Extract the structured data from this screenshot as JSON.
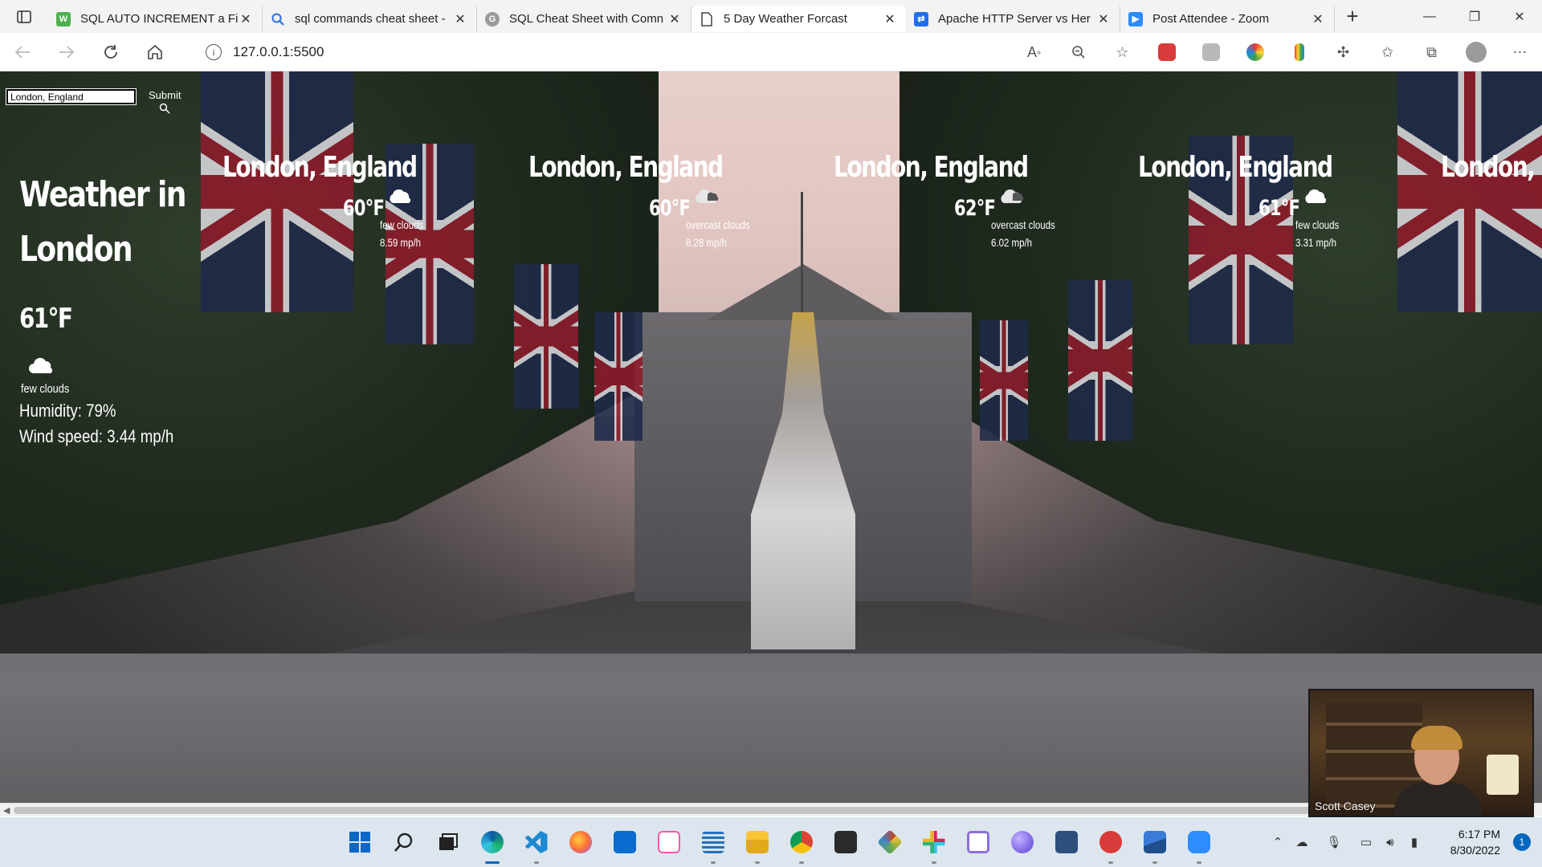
{
  "browser": {
    "tabs": [
      {
        "title": "SQL AUTO INCREMENT a Fi",
        "favicon": "w3schools-icon",
        "color": "#4caf50"
      },
      {
        "title": "sql commands cheat sheet -",
        "favicon": "search-icon",
        "color": "#2a6ee0"
      },
      {
        "title": "SQL Cheat Sheet with Comn",
        "favicon": "globe-icon",
        "color": "#888888"
      },
      {
        "title": "5 Day Weather Forcast",
        "favicon": "document-icon",
        "color": "#555555",
        "active": true
      },
      {
        "title": "Apache HTTP Server vs Her",
        "favicon": "share-icon",
        "color": "#1f6feb"
      },
      {
        "title": "Post Attendee - Zoom",
        "favicon": "zoom-icon",
        "color": "#2d8cff"
      }
    ],
    "url": "127.0.0.1:5500"
  },
  "weather": {
    "search": {
      "value": "London, England",
      "submit_label": "Submit"
    },
    "current": {
      "title": "Weather in London",
      "temp": "61°F",
      "description": "few clouds",
      "humidity": "Humidity: 79%",
      "wind": "Wind speed: 3.44 mp/h"
    },
    "forecast": [
      {
        "city": "London, England",
        "temp": "60°F",
        "description": "few clouds",
        "wind": "8.59 mp/h",
        "icon": "cloud-icon"
      },
      {
        "city": "London, England",
        "temp": "60°F",
        "description": "overcast clouds",
        "wind": "8.28 mp/h",
        "icon": "broken-clouds-icon"
      },
      {
        "city": "London, England",
        "temp": "62°F",
        "description": "overcast clouds",
        "wind": "6.02 mp/h",
        "icon": "broken-clouds-icon"
      },
      {
        "city": "London, England",
        "temp": "61°F",
        "description": "few clouds",
        "wind": "3.31 mp/h",
        "icon": "cloud-icon"
      },
      {
        "city": "London, England",
        "temp": "",
        "description": "",
        "wind": "",
        "icon": ""
      }
    ]
  },
  "zoom": {
    "participant_name": "Scott Casey"
  },
  "taskbar": {
    "apps": [
      "windows-start-icon",
      "search-icon",
      "task-view-icon",
      "edge-icon",
      "vscode-icon",
      "firefox-icon",
      "outlook-icon",
      "itunes-icon",
      "notepad-icon",
      "file-explorer-icon",
      "chrome-icon",
      "terminal-icon",
      "app-icon",
      "slack-icon",
      "snipping-tool-icon",
      "app-icon",
      "app-icon",
      "app-icon",
      "photos-icon",
      "zoom-icon"
    ],
    "time": "6:17 PM",
    "date": "8/30/2022",
    "notification_count": "1"
  },
  "colors": {
    "accent": "#0067c0",
    "taskbar_bg": "#dde6ee"
  }
}
